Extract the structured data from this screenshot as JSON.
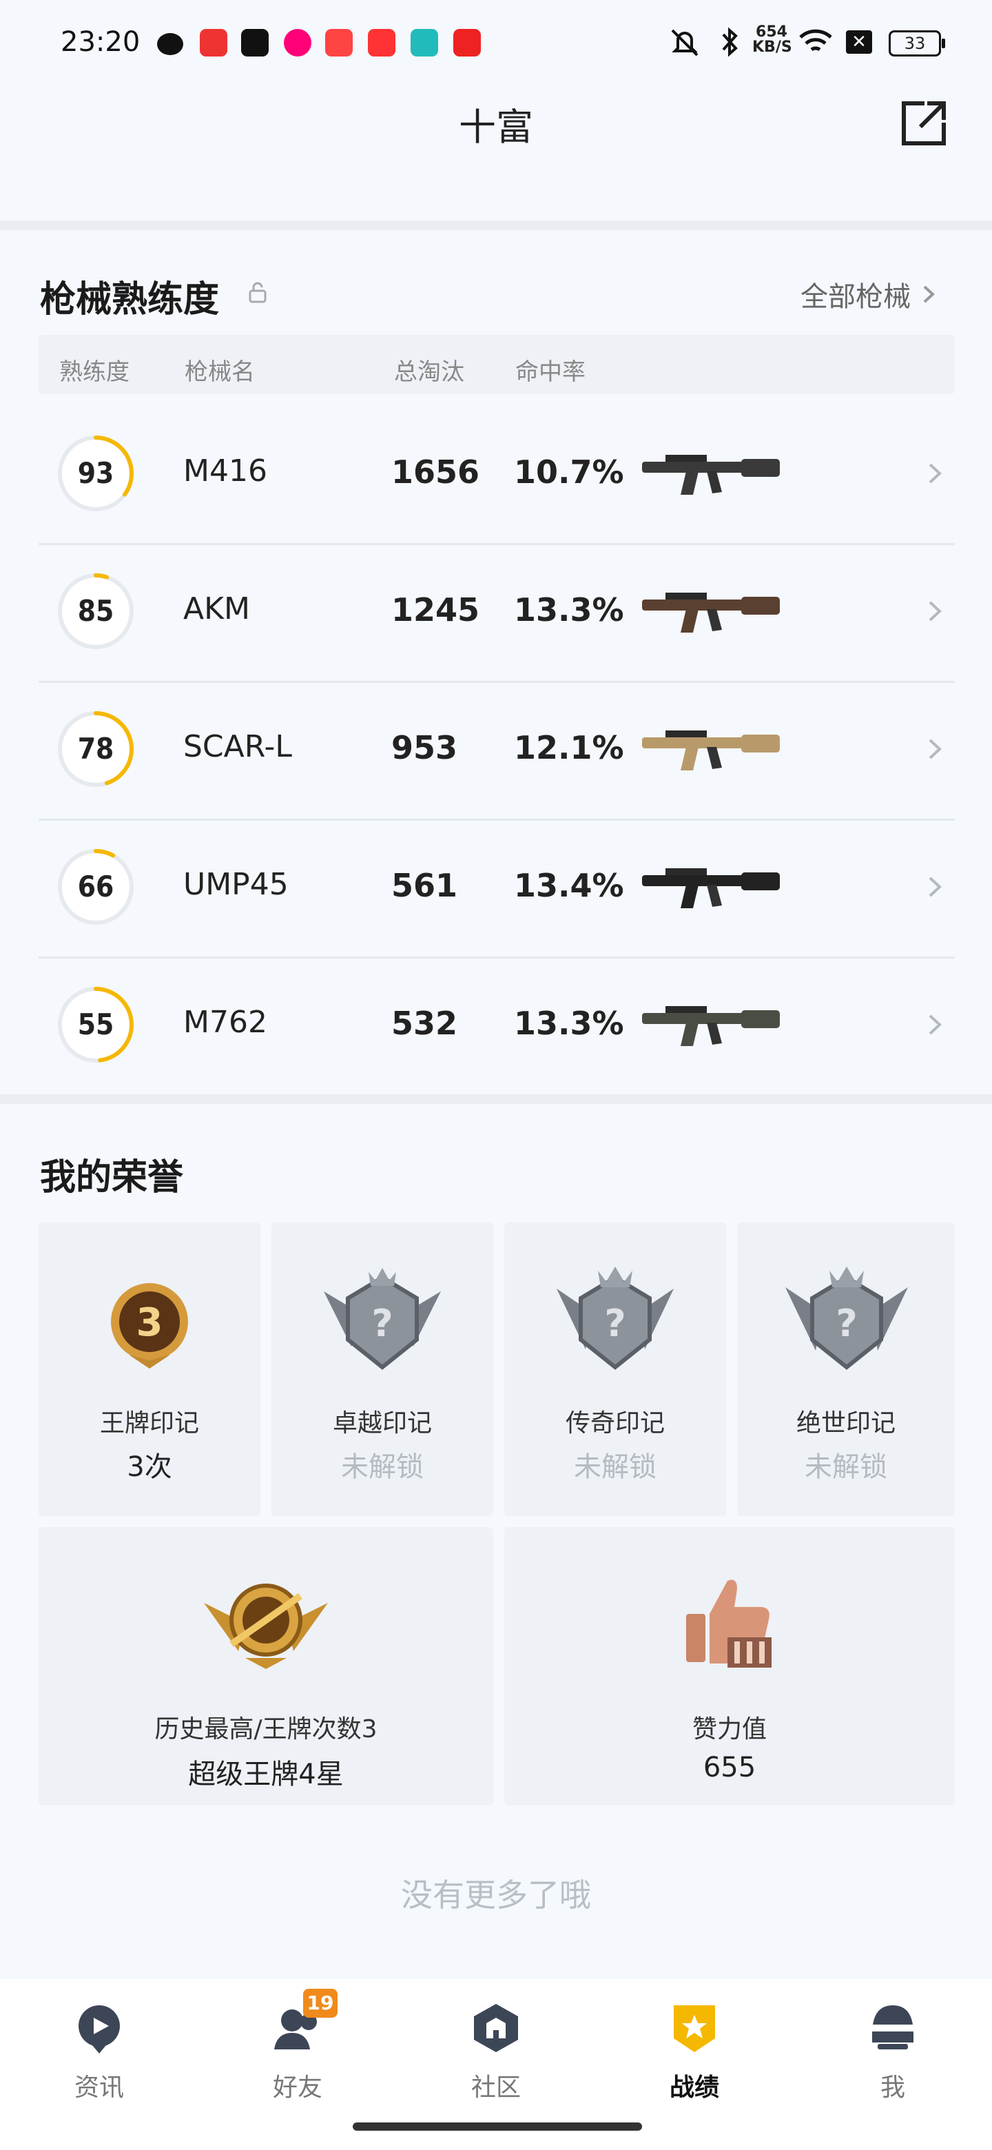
{
  "status_bar": {
    "time": "23:20",
    "net_speed": "654\nKB/S",
    "battery": "33"
  },
  "header": {
    "title": "十富"
  },
  "weapons": {
    "section_title": "枪械熟练度",
    "all_link": "全部枪械",
    "columns": {
      "proficiency": "熟练度",
      "name": "枪械名",
      "kills": "总淘汰",
      "hit_rate": "命中率"
    },
    "rows": [
      {
        "proficiency": "93",
        "name": "M416",
        "kills": "1656",
        "hit_rate": "10.7%",
        "progress": 0.35
      },
      {
        "proficiency": "85",
        "name": "AKM",
        "kills": "1245",
        "hit_rate": "13.3%",
        "progress": 0.05
      },
      {
        "proficiency": "78",
        "name": "SCAR-L",
        "kills": "953",
        "hit_rate": "12.1%",
        "progress": 0.45
      },
      {
        "proficiency": "66",
        "name": "UMP45",
        "kills": "561",
        "hit_rate": "13.4%",
        "progress": 0.08
      },
      {
        "proficiency": "55",
        "name": "M762",
        "kills": "532",
        "hit_rate": "13.3%",
        "progress": 0.48
      }
    ]
  },
  "honor": {
    "section_title": "我的荣誉",
    "marks": [
      {
        "label": "王牌印记",
        "value": "3次",
        "locked": false
      },
      {
        "label": "卓越印记",
        "value": "未解锁",
        "locked": true
      },
      {
        "label": "传奇印记",
        "value": "未解锁",
        "locked": true
      },
      {
        "label": "绝世印记",
        "value": "未解锁",
        "locked": true
      }
    ],
    "best": {
      "label": "历史最高/王牌次数3",
      "value": "超级王牌4星"
    },
    "likes": {
      "label": "赞力值",
      "value": "655"
    }
  },
  "footer_text": "没有更多了哦",
  "tabs": [
    {
      "label": "资讯",
      "icon": "news-icon"
    },
    {
      "label": "好友",
      "icon": "friends-icon",
      "badge": "19"
    },
    {
      "label": "社区",
      "icon": "community-icon"
    },
    {
      "label": "战绩",
      "icon": "record-icon",
      "active": true
    },
    {
      "label": "我",
      "icon": "profile-icon"
    }
  ],
  "colors": {
    "accent": "#f5b800",
    "tab_badge": "#f08a1c"
  }
}
